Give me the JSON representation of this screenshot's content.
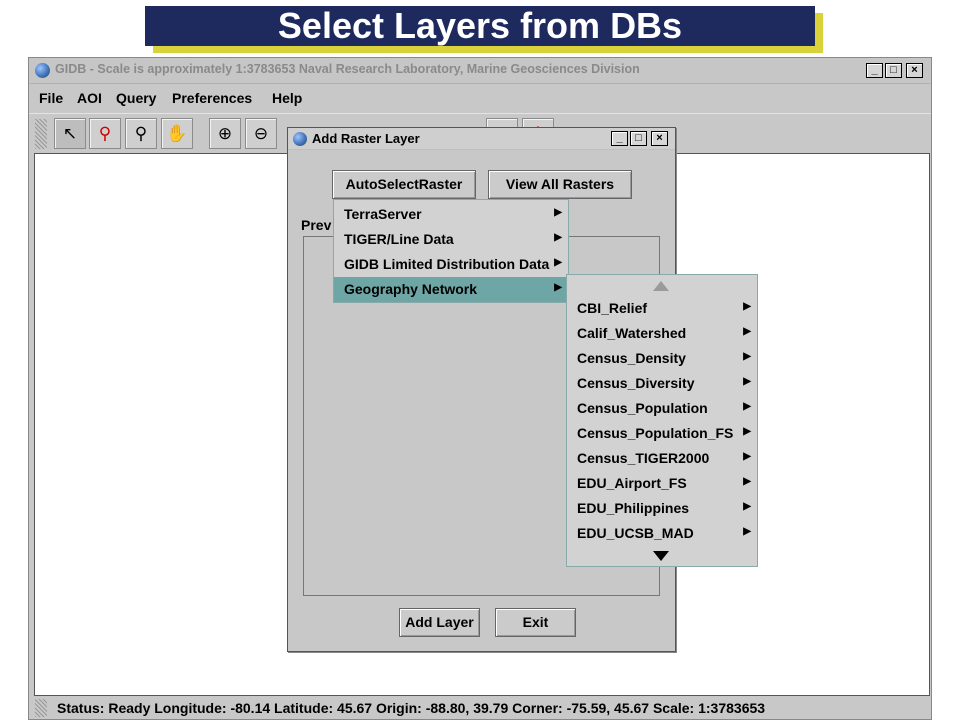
{
  "slide": {
    "title": "Select Layers from DBs"
  },
  "main_window": {
    "title": "GIDB - Scale is approximately 1:3783653   Naval Research Laboratory, Marine Geosciences Division",
    "controls": {
      "minimize": "_",
      "maximize": "□",
      "close": "×"
    },
    "menu": [
      "File",
      "AOI",
      "Query",
      "Preferences",
      "Help"
    ],
    "toolbar_icons": [
      "pointer-icon",
      "zoom-box-icon",
      "magnify-icon",
      "pan-hand-icon",
      "zoom-in-icon",
      "zoom-out-icon"
    ],
    "status": {
      "text": "Status: Ready   Longitude: -80.14   Latitude: 45.67   Origin: -88.80, 39.79   Corner: -75.59, 45.67   Scale: 1:3783653"
    }
  },
  "dialog": {
    "title": "Add Raster Layer",
    "controls": {
      "minimize": "_",
      "maximize": "□",
      "close": "×"
    },
    "auto_select_label": "AutoSelectRaster",
    "view_all_label": "View All Rasters",
    "preview_label": "Prev",
    "add_layer_label": "Add Layer",
    "exit_label": "Exit"
  },
  "db_menu": {
    "items": [
      {
        "label": "TerraServer"
      },
      {
        "label": "TIGER/Line Data"
      },
      {
        "label": "GIDB Limited Distribution Data"
      },
      {
        "label": "Geography Network"
      }
    ],
    "highlighted": "Geography Network"
  },
  "submenu": {
    "items": [
      {
        "label": "CBI_Relief"
      },
      {
        "label": "Calif_Watershed"
      },
      {
        "label": "Census_Density"
      },
      {
        "label": "Census_Diversity"
      },
      {
        "label": "Census_Population"
      },
      {
        "label": "Census_Population_FS"
      },
      {
        "label": "Census_TIGER2000"
      },
      {
        "label": "EDU_Airport_FS"
      },
      {
        "label": "EDU_Philippines"
      },
      {
        "label": "EDU_UCSB_MAD"
      }
    ]
  },
  "colors": {
    "title_bg": "#1e2a5e",
    "title_shadow": "#d9d23a",
    "menu_highlight": "#6ea6a6"
  }
}
